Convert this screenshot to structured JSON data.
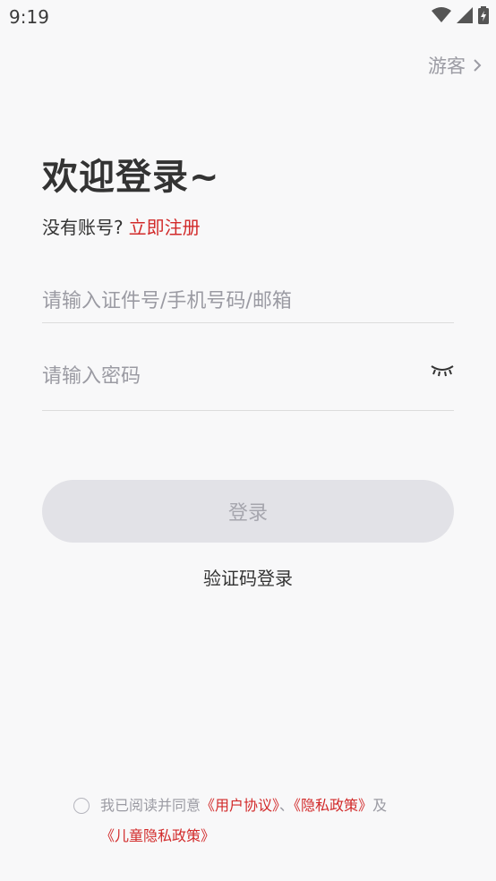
{
  "status": {
    "time": "9:19"
  },
  "guest": {
    "label": "游客"
  },
  "title": "欢迎登录~",
  "register": {
    "prompt": "没有账号?",
    "link": "立即注册"
  },
  "fields": {
    "account_placeholder": "请输入证件号/手机号码/邮箱",
    "password_placeholder": "请输入密码"
  },
  "login_button": "登录",
  "sms_login": "验证码登录",
  "agreement": {
    "prefix": "我已阅读并同意",
    "user_agreement": "《用户协议》",
    "sep": "、",
    "privacy": "《隐私政策》",
    "and": "及",
    "child_privacy": "《儿童隐私政策》"
  },
  "colors": {
    "accent_red": "#d22a2a",
    "placeholder": "#9b9ba3",
    "button_bg": "#e2e2e7"
  }
}
